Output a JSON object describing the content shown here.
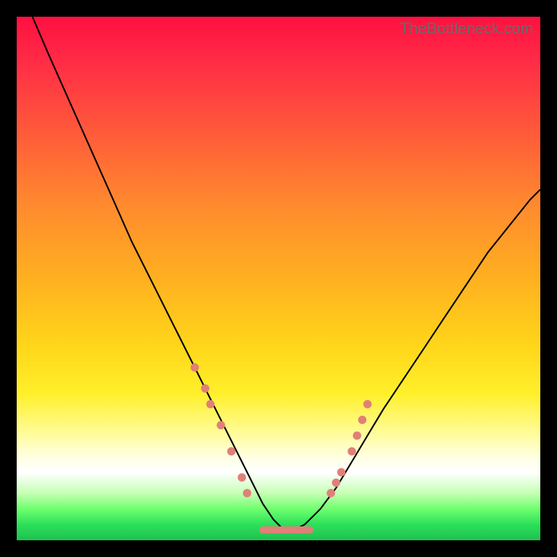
{
  "watermark": "TheBottleneck.com",
  "chart_data": {
    "type": "line",
    "title": "",
    "xlabel": "",
    "ylabel": "",
    "xlim": [
      0,
      100
    ],
    "ylim": [
      0,
      100
    ],
    "series": [
      {
        "name": "curve",
        "x": [
          3,
          6,
          10,
          14,
          18,
          22,
          26,
          30,
          34,
          37,
          40,
          43,
          45,
          47,
          49,
          51,
          53,
          55,
          58,
          61,
          64,
          67,
          70,
          74,
          78,
          82,
          86,
          90,
          94,
          98,
          100
        ],
        "y": [
          100,
          93,
          84,
          75,
          66,
          57,
          49,
          41,
          33,
          27,
          21,
          15,
          11,
          7,
          4,
          2,
          2,
          3,
          6,
          10,
          15,
          20,
          25,
          31,
          37,
          43,
          49,
          55,
          60,
          65,
          67
        ]
      }
    ],
    "markers": {
      "left_branch": [
        {
          "x": 34,
          "y": 33
        },
        {
          "x": 36,
          "y": 29
        },
        {
          "x": 37,
          "y": 26
        },
        {
          "x": 39,
          "y": 22
        },
        {
          "x": 41,
          "y": 17
        },
        {
          "x": 43,
          "y": 12
        },
        {
          "x": 44,
          "y": 9
        }
      ],
      "right_branch": [
        {
          "x": 60,
          "y": 9
        },
        {
          "x": 61,
          "y": 11
        },
        {
          "x": 62,
          "y": 13
        },
        {
          "x": 64,
          "y": 17
        },
        {
          "x": 65,
          "y": 20
        },
        {
          "x": 66,
          "y": 23
        },
        {
          "x": 67,
          "y": 26
        }
      ],
      "flat_segment": {
        "x_start": 47,
        "x_end": 56,
        "y": 2
      }
    },
    "grid": false,
    "legend": false
  },
  "colors": {
    "marker": "#e08078",
    "curve": "#000000"
  }
}
